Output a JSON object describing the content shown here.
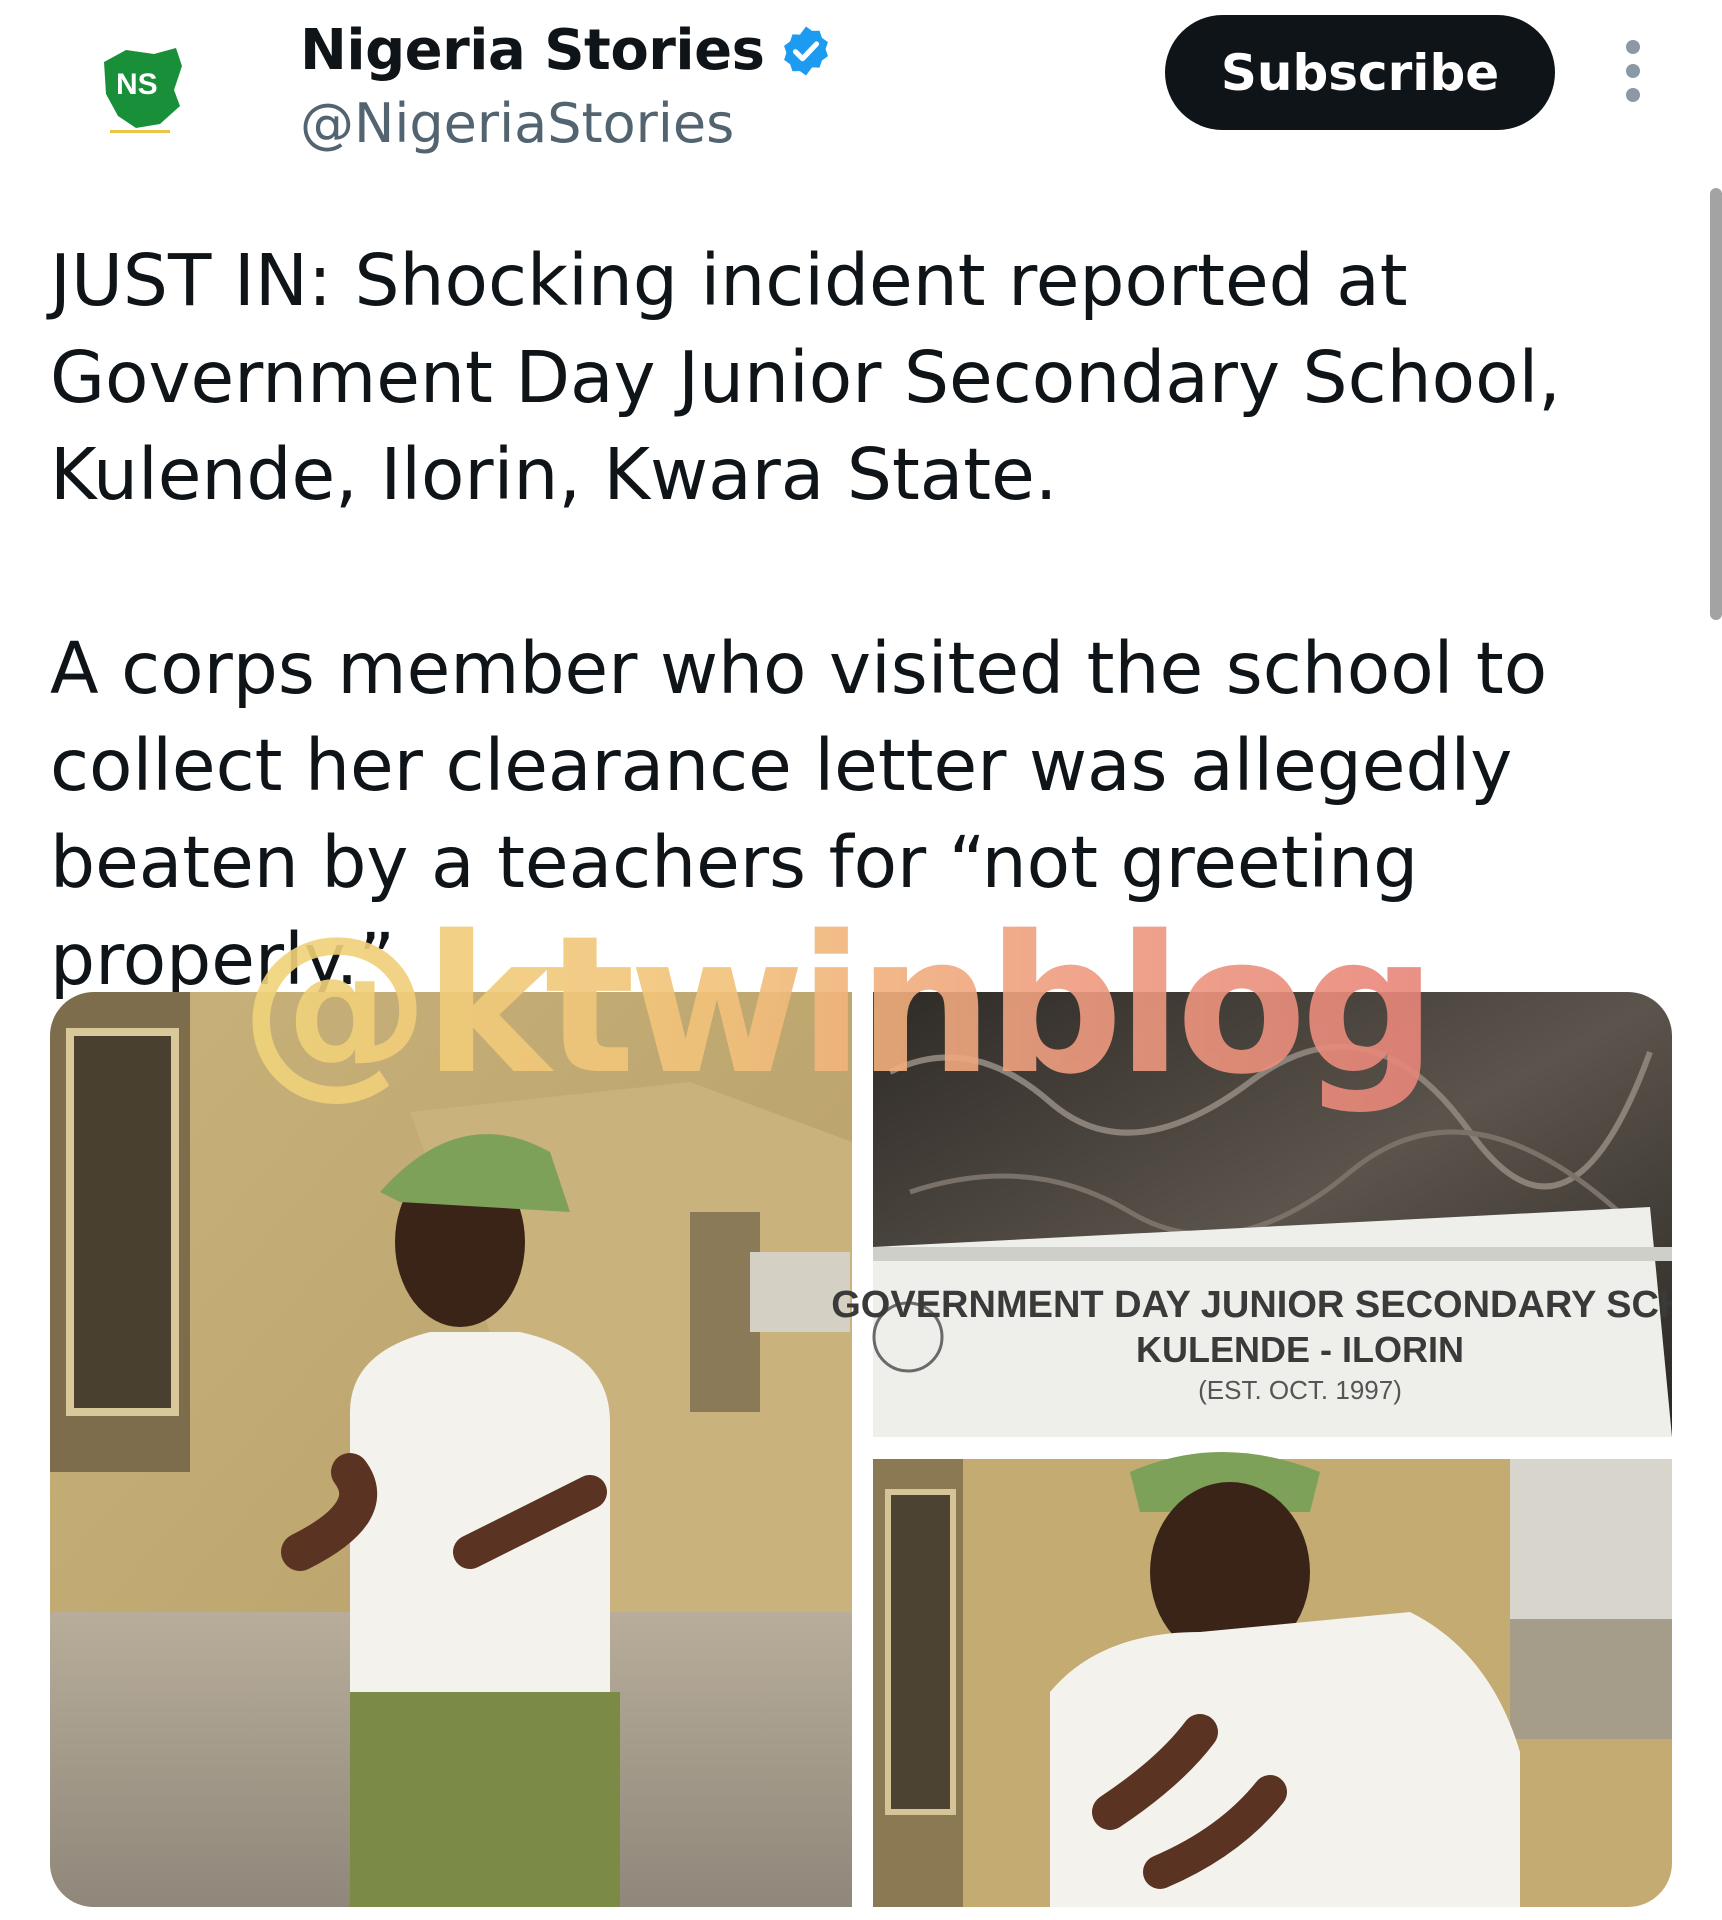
{
  "account": {
    "display_name": "Nigeria Stories",
    "handle": "@NigeriaStories",
    "logo_text": "NS",
    "verified": true
  },
  "actions": {
    "subscribe_label": "Subscribe",
    "more_icon": "more-vertical-icon"
  },
  "tweet": {
    "text": "JUST IN: Shocking incident reported at\nGovernment Day Junior Secondary School,\nKulende, Ilorin, Kwara State.\n\nA corps member who visited the school to\ncollect her clearance letter was allegedly\nbeaten by a teachers for “not greeting properly.”"
  },
  "media": {
    "sign_line1": "GOVERNMENT DAY JUNIOR SECONDARY SCHOOL",
    "sign_line2": "KULENDE - ILORIN",
    "sign_line3": "(EST. OCT. 1997)"
  },
  "watermark": "@ktwinblog",
  "colors": {
    "brand_green": "#1a8f3a",
    "verified_blue": "#1d9bf0",
    "button_bg": "#0f1419"
  }
}
